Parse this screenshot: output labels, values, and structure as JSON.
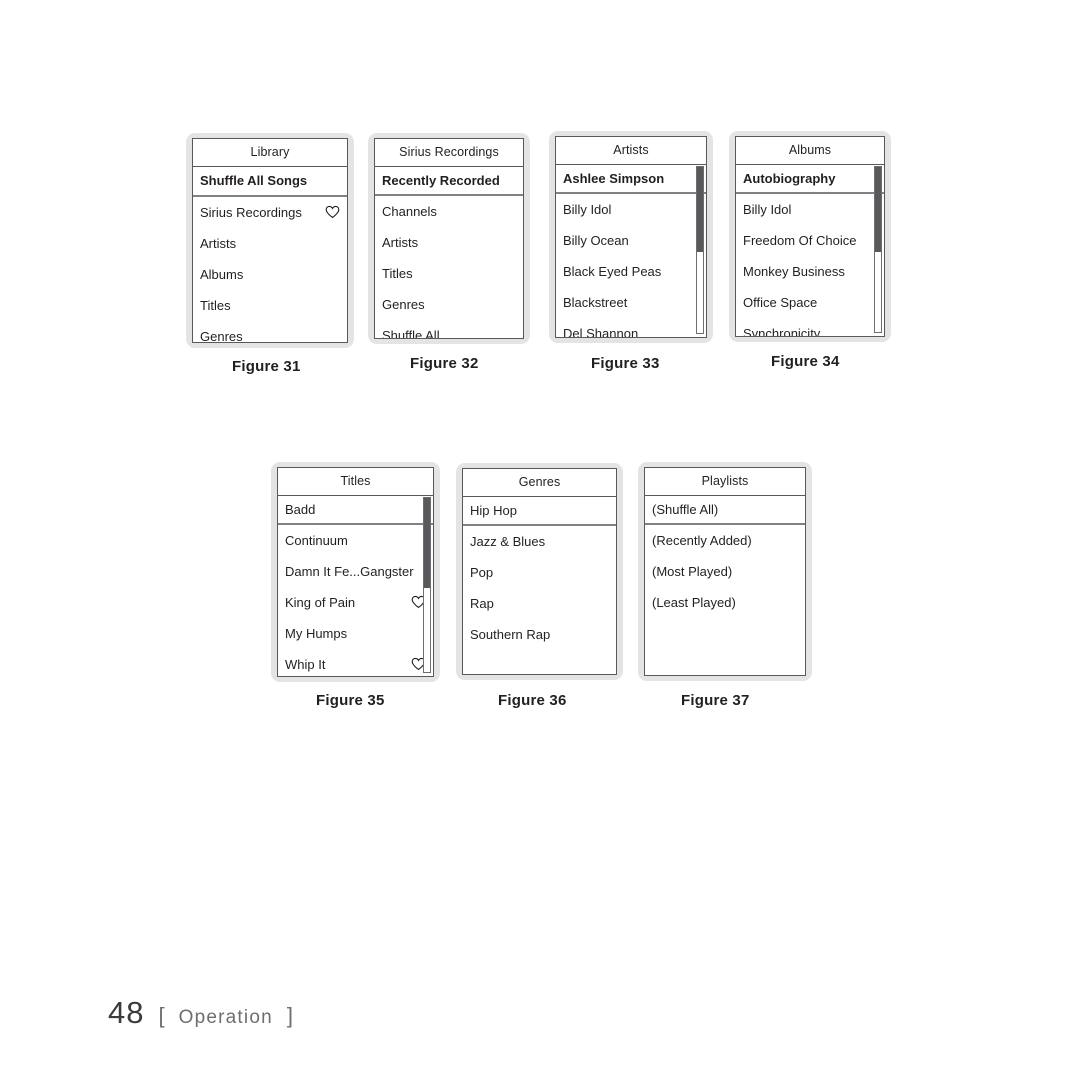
{
  "page": {
    "number": "48",
    "section_label": "Operation",
    "bracket_open": "[",
    "bracket_close": "]"
  },
  "figures": [
    {
      "caption": "Figure 31",
      "title": "Library",
      "has_scrollbar": false,
      "items": [
        {
          "label": "Shuffle All Songs",
          "selected": true,
          "heart": false
        },
        {
          "label": "Sirius Recordings",
          "selected": false,
          "heart": true
        },
        {
          "label": "Artists",
          "selected": false,
          "heart": false
        },
        {
          "label": "Albums",
          "selected": false,
          "heart": false
        },
        {
          "label": "Titles",
          "selected": false,
          "heart": false
        },
        {
          "label": "Genres",
          "selected": false,
          "heart": false
        }
      ]
    },
    {
      "caption": "Figure 32",
      "title": "Sirius Recordings",
      "has_scrollbar": false,
      "items": [
        {
          "label": "Recently Recorded",
          "selected": true,
          "heart": false
        },
        {
          "label": "Channels",
          "selected": false,
          "heart": false
        },
        {
          "label": "Artists",
          "selected": false,
          "heart": false
        },
        {
          "label": "Titles",
          "selected": false,
          "heart": false
        },
        {
          "label": "Genres",
          "selected": false,
          "heart": false
        },
        {
          "label": "Shuffle All",
          "selected": false,
          "heart": false
        }
      ]
    },
    {
      "caption": "Figure 33",
      "title": "Artists",
      "has_scrollbar": true,
      "items": [
        {
          "label": "Ashlee Simpson",
          "selected": true,
          "heart": false
        },
        {
          "label": "Billy Idol",
          "selected": false,
          "heart": false
        },
        {
          "label": "Billy Ocean",
          "selected": false,
          "heart": false
        },
        {
          "label": "Black Eyed Peas",
          "selected": false,
          "heart": false
        },
        {
          "label": "Blackstreet",
          "selected": false,
          "heart": false
        },
        {
          "label": "Del Shannon",
          "selected": false,
          "heart": false
        }
      ]
    },
    {
      "caption": "Figure 34",
      "title": "Albums",
      "has_scrollbar": true,
      "items": [
        {
          "label": "Autobiography",
          "selected": true,
          "heart": false
        },
        {
          "label": "Billy Idol",
          "selected": false,
          "heart": false
        },
        {
          "label": "Freedom Of Choice",
          "selected": false,
          "heart": false
        },
        {
          "label": "Monkey Business",
          "selected": false,
          "heart": false
        },
        {
          "label": "Office Space",
          "selected": false,
          "heart": false
        },
        {
          "label": "Synchronicity",
          "selected": false,
          "heart": false
        }
      ]
    },
    {
      "caption": "Figure 35",
      "title": "Titles",
      "has_scrollbar": true,
      "items": [
        {
          "label": "Badd",
          "selected": true,
          "heart": false
        },
        {
          "label": "Continuum",
          "selected": false,
          "heart": false
        },
        {
          "label": "Damn It Fe...Gangster",
          "selected": false,
          "heart": false
        },
        {
          "label": "King of Pain",
          "selected": false,
          "heart": true
        },
        {
          "label": "My Humps",
          "selected": false,
          "heart": false
        },
        {
          "label": "Whip It",
          "selected": false,
          "heart": true
        }
      ]
    },
    {
      "caption": "Figure 36",
      "title": "Genres",
      "has_scrollbar": false,
      "items": [
        {
          "label": "Hip Hop",
          "selected": true,
          "heart": false
        },
        {
          "label": "Jazz & Blues",
          "selected": false,
          "heart": false
        },
        {
          "label": "Pop",
          "selected": false,
          "heart": false
        },
        {
          "label": "Rap",
          "selected": false,
          "heart": false
        },
        {
          "label": "Southern Rap",
          "selected": false,
          "heart": false
        }
      ]
    },
    {
      "caption": "Figure 37",
      "title": "Playlists",
      "has_scrollbar": false,
      "items": [
        {
          "label": "(Shuffle All)",
          "selected": true,
          "heart": false
        },
        {
          "label": "(Recently Added)",
          "selected": false,
          "heart": false
        },
        {
          "label": "(Most Played)",
          "selected": false,
          "heart": false
        },
        {
          "label": "(Least Played)",
          "selected": false,
          "heart": false
        }
      ]
    }
  ],
  "colors": {
    "page_background": "#ffffff",
    "device_frame": "#e4e4e4",
    "screen_border": "#58595b",
    "text": "#231f20",
    "selected_rule": "#808285",
    "footer_text": "#6d6e71"
  }
}
